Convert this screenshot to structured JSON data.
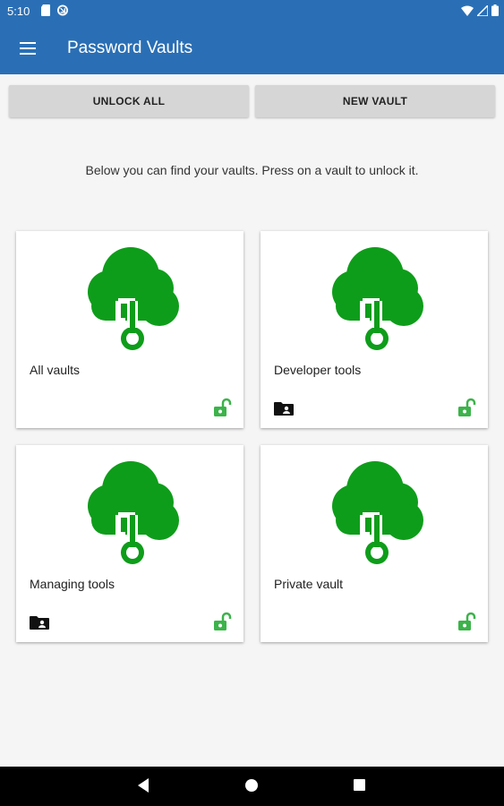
{
  "status": {
    "time": "5:10"
  },
  "app": {
    "title": "Password Vaults"
  },
  "actions": {
    "unlock_all": "UNLOCK ALL",
    "new_vault": "NEW VAULT"
  },
  "info": "Below you can find your vaults. Press on a vault to unlock it.",
  "vaults": [
    {
      "name": "All vaults",
      "has_folder": false,
      "lock_state": "unlocked"
    },
    {
      "name": "Developer tools",
      "has_folder": true,
      "lock_state": "unlocked"
    },
    {
      "name": "Managing tools",
      "has_folder": true,
      "lock_state": "unlocked"
    },
    {
      "name": "Private vault",
      "has_folder": false,
      "lock_state": "unlocked"
    }
  ],
  "colors": {
    "appbar": "#2a6fb5",
    "accent_green": "#0e9d1a",
    "lock_green": "#3cb34a"
  },
  "icons": {
    "menu": "hamburger-icon",
    "vault": "cloud-key-icon",
    "lock": "unlocked-padlock-icon",
    "folder": "shared-folder-icon",
    "nav_back": "back-triangle-icon",
    "nav_home": "home-circle-icon",
    "nav_recents": "recents-square-icon"
  }
}
